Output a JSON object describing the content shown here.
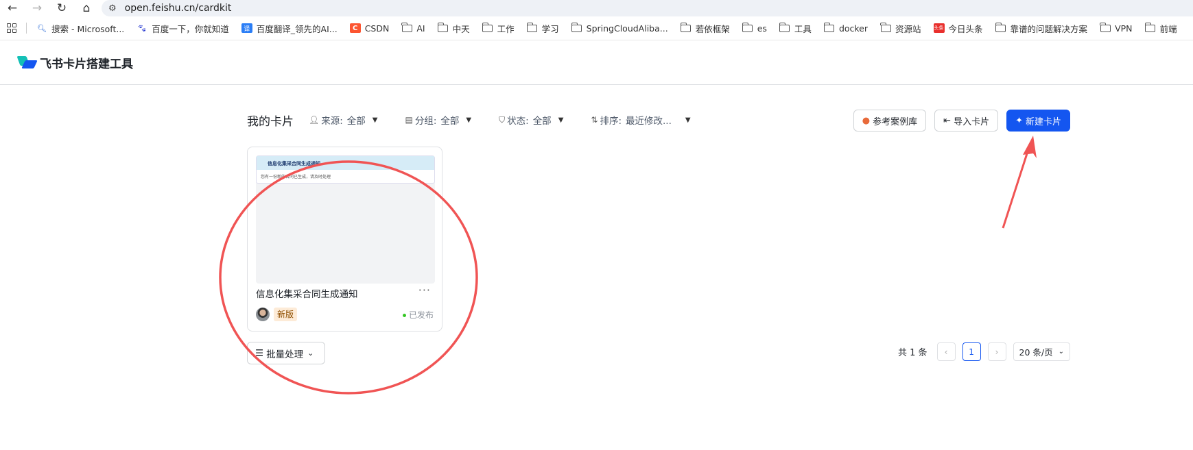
{
  "browser": {
    "url": "open.feishu.cn/cardkit",
    "bookmarks": [
      {
        "label": "搜索 - Microsoft...",
        "icon": "search-icon"
      },
      {
        "label": "百度一下，你就知道",
        "icon": "baidu-icon"
      },
      {
        "label": "百度翻译_领先的AI...",
        "icon": "translate-icon"
      },
      {
        "label": "CSDN",
        "icon": "csdn-icon"
      },
      {
        "label": "AI",
        "icon": "folder-icon"
      },
      {
        "label": "中天",
        "icon": "folder-icon"
      },
      {
        "label": "工作",
        "icon": "folder-icon"
      },
      {
        "label": "学习",
        "icon": "folder-icon"
      },
      {
        "label": "SpringCloudAliba...",
        "icon": "folder-icon"
      },
      {
        "label": "若依框架",
        "icon": "folder-icon"
      },
      {
        "label": "es",
        "icon": "folder-icon"
      },
      {
        "label": "工具",
        "icon": "folder-icon"
      },
      {
        "label": "docker",
        "icon": "folder-icon"
      },
      {
        "label": "资源站",
        "icon": "folder-icon"
      },
      {
        "label": "今日头条",
        "icon": "toutiao-icon"
      },
      {
        "label": "靠谱的问题解决方案",
        "icon": "folder-icon"
      },
      {
        "label": "VPN",
        "icon": "folder-icon"
      },
      {
        "label": "前端",
        "icon": "folder-icon"
      }
    ]
  },
  "app": {
    "title": "飞书卡片搭建工具"
  },
  "toolbar": {
    "page_title": "我的卡片",
    "filters": {
      "source_label": "来源:",
      "source_value": "全部",
      "group_label": "分组:",
      "group_value": "全部",
      "status_label": "状态:",
      "status_value": "全部",
      "sort_label": "排序:",
      "sort_value": "最近修改..."
    },
    "reference_button": "参考案例库",
    "import_button": "导入卡片",
    "new_button": "新建卡片"
  },
  "cards": [
    {
      "name": "信息化集采合同生成通知",
      "preview_title": "信息化集采合同生成通知",
      "preview_body": "您有一份新的合同已生成，请及时处理",
      "badge": "新版",
      "status": "已发布",
      "more": "···"
    }
  ],
  "batch": {
    "label": "批量处理"
  },
  "pagination": {
    "total": "共 1 条",
    "current_page": "1",
    "page_size": "20 条/页"
  },
  "colors": {
    "primary": "#1456f0",
    "annotation": "#f05454",
    "badge_bg": "#fdebd7",
    "status_dot": "#34c724"
  }
}
